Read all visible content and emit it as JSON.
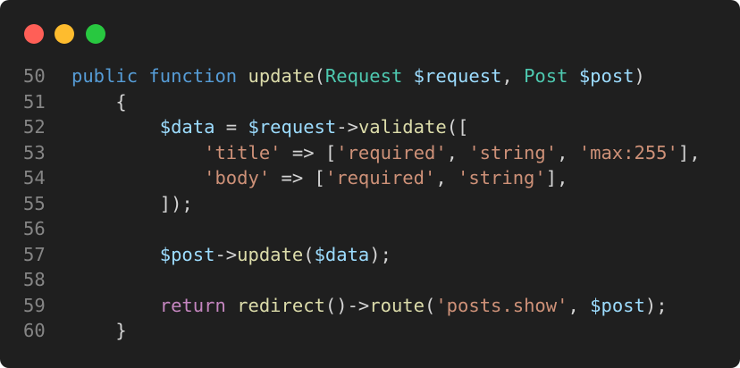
{
  "window": {
    "controls": {
      "close_color": "#ff5f57",
      "minimize_color": "#febc2e",
      "maximize_color": "#28c840"
    }
  },
  "code": {
    "lines": [
      {
        "number": "50",
        "tokens": [
          {
            "text": "public",
            "kind": "kw"
          },
          {
            "text": " ",
            "kind": "plain"
          },
          {
            "text": "function",
            "kind": "kw"
          },
          {
            "text": " ",
            "kind": "plain"
          },
          {
            "text": "update",
            "kind": "fn"
          },
          {
            "text": "(",
            "kind": "plain"
          },
          {
            "text": "Request",
            "kind": "type"
          },
          {
            "text": " ",
            "kind": "plain"
          },
          {
            "text": "$request",
            "kind": "var"
          },
          {
            "text": ", ",
            "kind": "plain"
          },
          {
            "text": "Post",
            "kind": "type"
          },
          {
            "text": " ",
            "kind": "plain"
          },
          {
            "text": "$post",
            "kind": "var"
          },
          {
            "text": ")",
            "kind": "plain"
          }
        ]
      },
      {
        "number": "51",
        "tokens": [
          {
            "text": "    {",
            "kind": "plain"
          }
        ]
      },
      {
        "number": "52",
        "tokens": [
          {
            "text": "        ",
            "kind": "plain"
          },
          {
            "text": "$data",
            "kind": "var"
          },
          {
            "text": " = ",
            "kind": "plain"
          },
          {
            "text": "$request",
            "kind": "var"
          },
          {
            "text": "->",
            "kind": "plain"
          },
          {
            "text": "validate",
            "kind": "fn"
          },
          {
            "text": "([",
            "kind": "plain"
          }
        ]
      },
      {
        "number": "53",
        "tokens": [
          {
            "text": "            ",
            "kind": "plain"
          },
          {
            "text": "'title'",
            "kind": "str"
          },
          {
            "text": " => [",
            "kind": "plain"
          },
          {
            "text": "'required'",
            "kind": "str"
          },
          {
            "text": ", ",
            "kind": "plain"
          },
          {
            "text": "'string'",
            "kind": "str"
          },
          {
            "text": ", ",
            "kind": "plain"
          },
          {
            "text": "'max:255'",
            "kind": "str"
          },
          {
            "text": "],",
            "kind": "plain"
          }
        ]
      },
      {
        "number": "54",
        "tokens": [
          {
            "text": "            ",
            "kind": "plain"
          },
          {
            "text": "'body'",
            "kind": "str"
          },
          {
            "text": " => [",
            "kind": "plain"
          },
          {
            "text": "'required'",
            "kind": "str"
          },
          {
            "text": ", ",
            "kind": "plain"
          },
          {
            "text": "'string'",
            "kind": "str"
          },
          {
            "text": "],",
            "kind": "plain"
          }
        ]
      },
      {
        "number": "55",
        "tokens": [
          {
            "text": "        ]);",
            "kind": "plain"
          }
        ]
      },
      {
        "number": "56",
        "tokens": []
      },
      {
        "number": "57",
        "tokens": [
          {
            "text": "        ",
            "kind": "plain"
          },
          {
            "text": "$post",
            "kind": "var"
          },
          {
            "text": "->",
            "kind": "plain"
          },
          {
            "text": "update",
            "kind": "fn"
          },
          {
            "text": "(",
            "kind": "plain"
          },
          {
            "text": "$data",
            "kind": "var"
          },
          {
            "text": ");",
            "kind": "plain"
          }
        ]
      },
      {
        "number": "58",
        "tokens": []
      },
      {
        "number": "59",
        "tokens": [
          {
            "text": "        ",
            "kind": "plain"
          },
          {
            "text": "return",
            "kind": "ctrl"
          },
          {
            "text": " ",
            "kind": "plain"
          },
          {
            "text": "redirect",
            "kind": "fn"
          },
          {
            "text": "()->",
            "kind": "plain"
          },
          {
            "text": "route",
            "kind": "fn"
          },
          {
            "text": "(",
            "kind": "plain"
          },
          {
            "text": "'posts.show'",
            "kind": "str"
          },
          {
            "text": ", ",
            "kind": "plain"
          },
          {
            "text": "$post",
            "kind": "var"
          },
          {
            "text": ");",
            "kind": "plain"
          }
        ]
      },
      {
        "number": "60",
        "tokens": [
          {
            "text": "    }",
            "kind": "plain"
          }
        ]
      }
    ]
  }
}
